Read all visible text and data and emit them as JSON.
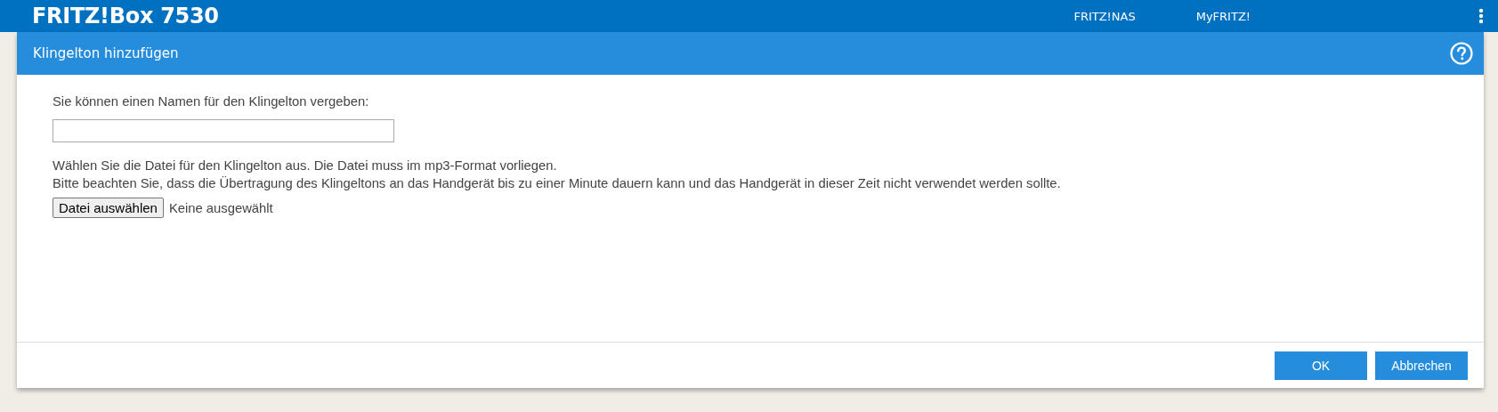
{
  "topbar": {
    "title": "FRITZ!Box 7530",
    "links": [
      "FRITZ!NAS",
      "MyFRITZ!"
    ]
  },
  "dialog": {
    "title": "Klingelton hinzufügen",
    "name_label": "Sie können einen Namen für den Klingelton vergeben:",
    "file_hint": [
      "Wählen Sie die Datei für den Klingelton aus. Die Datei muss im mp3-Format vorliegen.",
      "Bitte beachten Sie, dass die Übertragung des Klingeltons an das Handgerät bis zu einer Minute dauern kann und das Handgerät in dieser Zeit nicht verwendet werden sollte."
    ],
    "file_button": "Datei auswählen",
    "file_status": "Keine ausgewählt",
    "buttons": [
      "OK",
      "Abbrechen"
    ]
  }
}
